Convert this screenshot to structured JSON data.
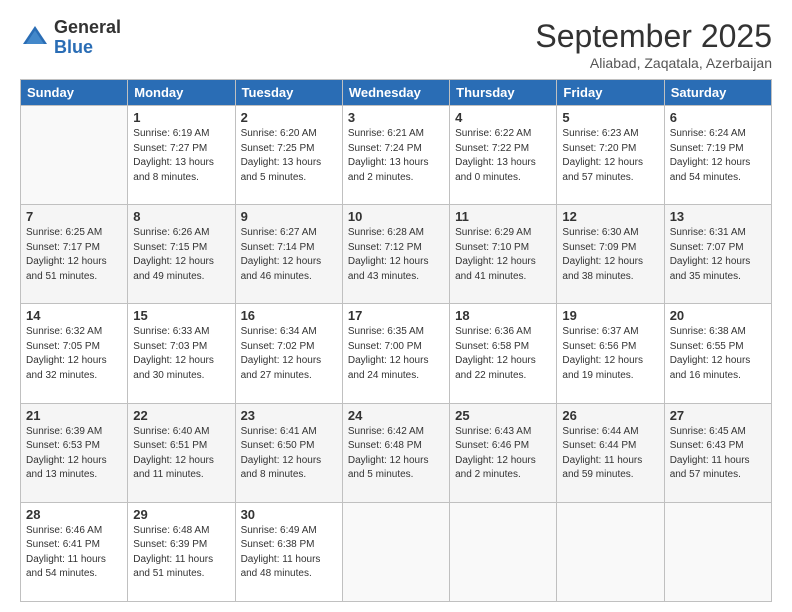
{
  "logo": {
    "general": "General",
    "blue": "Blue"
  },
  "title": "September 2025",
  "subtitle": "Aliabad, Zaqatala, Azerbaijan",
  "days_header": [
    "Sunday",
    "Monday",
    "Tuesday",
    "Wednesday",
    "Thursday",
    "Friday",
    "Saturday"
  ],
  "weeks": [
    [
      {
        "day": "",
        "info": ""
      },
      {
        "day": "1",
        "info": "Sunrise: 6:19 AM\nSunset: 7:27 PM\nDaylight: 13 hours\nand 8 minutes."
      },
      {
        "day": "2",
        "info": "Sunrise: 6:20 AM\nSunset: 7:25 PM\nDaylight: 13 hours\nand 5 minutes."
      },
      {
        "day": "3",
        "info": "Sunrise: 6:21 AM\nSunset: 7:24 PM\nDaylight: 13 hours\nand 2 minutes."
      },
      {
        "day": "4",
        "info": "Sunrise: 6:22 AM\nSunset: 7:22 PM\nDaylight: 13 hours\nand 0 minutes."
      },
      {
        "day": "5",
        "info": "Sunrise: 6:23 AM\nSunset: 7:20 PM\nDaylight: 12 hours\nand 57 minutes."
      },
      {
        "day": "6",
        "info": "Sunrise: 6:24 AM\nSunset: 7:19 PM\nDaylight: 12 hours\nand 54 minutes."
      }
    ],
    [
      {
        "day": "7",
        "info": "Sunrise: 6:25 AM\nSunset: 7:17 PM\nDaylight: 12 hours\nand 51 minutes."
      },
      {
        "day": "8",
        "info": "Sunrise: 6:26 AM\nSunset: 7:15 PM\nDaylight: 12 hours\nand 49 minutes."
      },
      {
        "day": "9",
        "info": "Sunrise: 6:27 AM\nSunset: 7:14 PM\nDaylight: 12 hours\nand 46 minutes."
      },
      {
        "day": "10",
        "info": "Sunrise: 6:28 AM\nSunset: 7:12 PM\nDaylight: 12 hours\nand 43 minutes."
      },
      {
        "day": "11",
        "info": "Sunrise: 6:29 AM\nSunset: 7:10 PM\nDaylight: 12 hours\nand 41 minutes."
      },
      {
        "day": "12",
        "info": "Sunrise: 6:30 AM\nSunset: 7:09 PM\nDaylight: 12 hours\nand 38 minutes."
      },
      {
        "day": "13",
        "info": "Sunrise: 6:31 AM\nSunset: 7:07 PM\nDaylight: 12 hours\nand 35 minutes."
      }
    ],
    [
      {
        "day": "14",
        "info": "Sunrise: 6:32 AM\nSunset: 7:05 PM\nDaylight: 12 hours\nand 32 minutes."
      },
      {
        "day": "15",
        "info": "Sunrise: 6:33 AM\nSunset: 7:03 PM\nDaylight: 12 hours\nand 30 minutes."
      },
      {
        "day": "16",
        "info": "Sunrise: 6:34 AM\nSunset: 7:02 PM\nDaylight: 12 hours\nand 27 minutes."
      },
      {
        "day": "17",
        "info": "Sunrise: 6:35 AM\nSunset: 7:00 PM\nDaylight: 12 hours\nand 24 minutes."
      },
      {
        "day": "18",
        "info": "Sunrise: 6:36 AM\nSunset: 6:58 PM\nDaylight: 12 hours\nand 22 minutes."
      },
      {
        "day": "19",
        "info": "Sunrise: 6:37 AM\nSunset: 6:56 PM\nDaylight: 12 hours\nand 19 minutes."
      },
      {
        "day": "20",
        "info": "Sunrise: 6:38 AM\nSunset: 6:55 PM\nDaylight: 12 hours\nand 16 minutes."
      }
    ],
    [
      {
        "day": "21",
        "info": "Sunrise: 6:39 AM\nSunset: 6:53 PM\nDaylight: 12 hours\nand 13 minutes."
      },
      {
        "day": "22",
        "info": "Sunrise: 6:40 AM\nSunset: 6:51 PM\nDaylight: 12 hours\nand 11 minutes."
      },
      {
        "day": "23",
        "info": "Sunrise: 6:41 AM\nSunset: 6:50 PM\nDaylight: 12 hours\nand 8 minutes."
      },
      {
        "day": "24",
        "info": "Sunrise: 6:42 AM\nSunset: 6:48 PM\nDaylight: 12 hours\nand 5 minutes."
      },
      {
        "day": "25",
        "info": "Sunrise: 6:43 AM\nSunset: 6:46 PM\nDaylight: 12 hours\nand 2 minutes."
      },
      {
        "day": "26",
        "info": "Sunrise: 6:44 AM\nSunset: 6:44 PM\nDaylight: 11 hours\nand 59 minutes."
      },
      {
        "day": "27",
        "info": "Sunrise: 6:45 AM\nSunset: 6:43 PM\nDaylight: 11 hours\nand 57 minutes."
      }
    ],
    [
      {
        "day": "28",
        "info": "Sunrise: 6:46 AM\nSunset: 6:41 PM\nDaylight: 11 hours\nand 54 minutes."
      },
      {
        "day": "29",
        "info": "Sunrise: 6:48 AM\nSunset: 6:39 PM\nDaylight: 11 hours\nand 51 minutes."
      },
      {
        "day": "30",
        "info": "Sunrise: 6:49 AM\nSunset: 6:38 PM\nDaylight: 11 hours\nand 48 minutes."
      },
      {
        "day": "",
        "info": ""
      },
      {
        "day": "",
        "info": ""
      },
      {
        "day": "",
        "info": ""
      },
      {
        "day": "",
        "info": ""
      }
    ]
  ]
}
